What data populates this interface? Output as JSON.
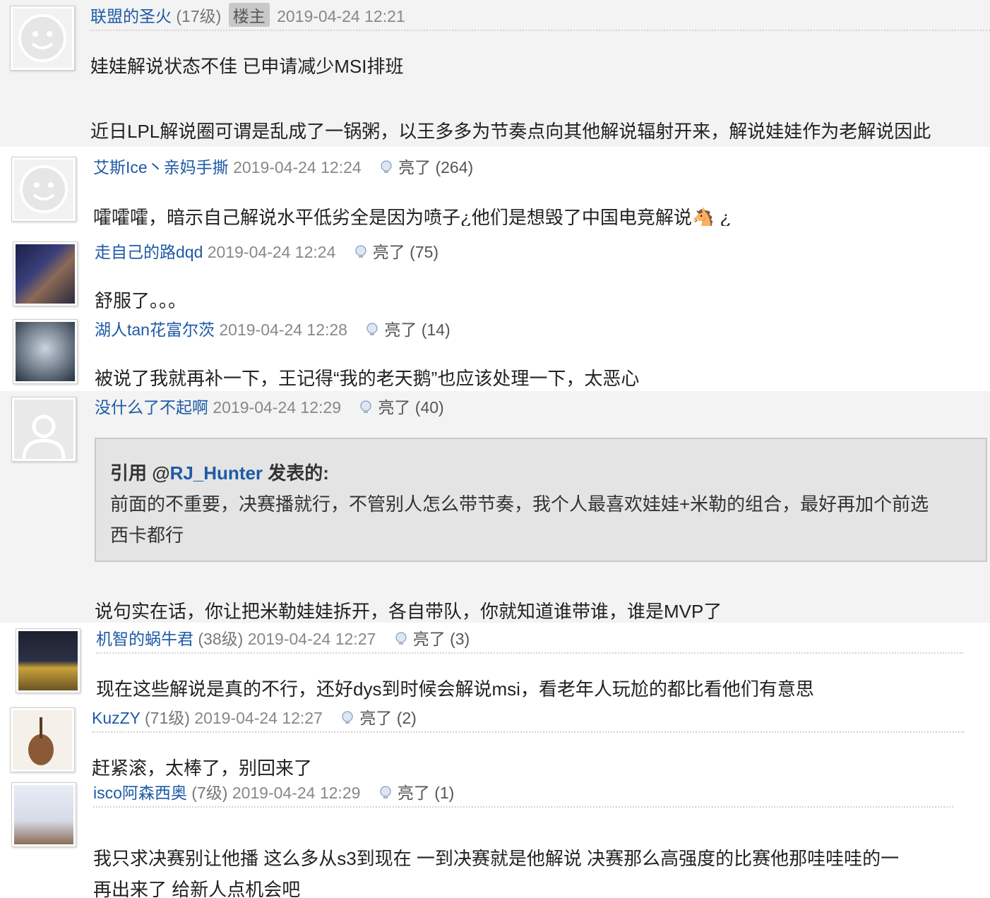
{
  "posts": [
    {
      "user": "联盟的圣火",
      "level": "(17级)",
      "tag": "楼主",
      "time": "2019-04-24 12:21",
      "lines": [
        "娃娃解说状态不佳 已申请减少MSI排班",
        "近日LPL解说圈可谓是乱成了一锅粥，以王多多为节奏点向其他解说辐射开来，解说娃娃作为老解说因此"
      ]
    },
    {
      "user": "艾斯Ice丶亲妈手撕",
      "time": "2019-04-24 12:24",
      "light_label": "亮了",
      "light_count": "(264)",
      "lines": [
        "嚯嚯嚯，暗示自己解说水平低劣全是因为喷子¿他们是想毁了中国电竞解说🐴 ¿"
      ]
    },
    {
      "user": "走自己的路dqd",
      "time": "2019-04-24 12:24",
      "light_label": "亮了",
      "light_count": "(75)",
      "lines": [
        "舒服了。。。"
      ]
    },
    {
      "user": "湖人tan花富尔茨",
      "time": "2019-04-24 12:28",
      "light_label": "亮了",
      "light_count": "(14)",
      "lines": [
        "被说了我就再补一下，王记得“我的老天鹅”也应该处理一下，太恶心"
      ]
    },
    {
      "user": "没什么了不起啊",
      "time": "2019-04-24 12:29",
      "light_label": "亮了",
      "light_count": "(40)",
      "quote": {
        "prefix": "引用 @",
        "user": "RJ_Hunter",
        "suffix": " 发表的:",
        "lines": [
          "前面的不重要，决赛播就行，不管别人怎么带节奏，我个人最喜欢娃娃+米勒的组合，最好再加个前选",
          "西卡都行"
        ]
      },
      "lines": [
        "说句实在话，你让把米勒娃娃拆开，各自带队，你就知道谁带谁，谁是MVP了"
      ]
    },
    {
      "user": "机智的蜗牛君",
      "level": "(38级)",
      "time": "2019-04-24 12:27",
      "light_label": "亮了",
      "light_count": "(3)",
      "lines": [
        "现在这些解说是真的不行，还好dys到时候会解说msi，看老年人玩尬的都比看他们有意思"
      ]
    },
    {
      "user": "KuzZY",
      "level": "(71级)",
      "time": "2019-04-24 12:27",
      "light_label": "亮了",
      "light_count": "(2)",
      "lines": [
        "赶紧滚，太棒了，别回来了"
      ]
    },
    {
      "user": "isco阿森西奥",
      "level": "(7级)",
      "time": "2019-04-24 12:29",
      "light_label": "亮了",
      "light_count": "(1)",
      "lines": [
        "我只求决赛别让他播 这么多从s3到现在 一到决赛就是他解说 决赛那么高强度的比赛他那哇哇哇的一",
        "再出来了 给新人点机会吧"
      ]
    }
  ]
}
